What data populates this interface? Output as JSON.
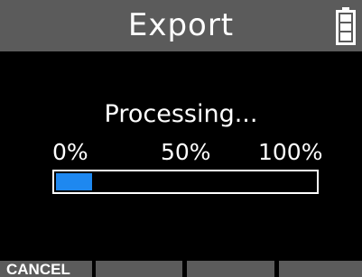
{
  "header": {
    "title": "Export",
    "battery_icon": "battery-full-icon"
  },
  "main": {
    "status_text": "Processing...",
    "progress": {
      "scale_min": "0%",
      "scale_mid": "50%",
      "scale_max": "100%",
      "value_fraction": 0.14,
      "fill_color": "#1e88f0"
    }
  },
  "softkeys": [
    {
      "label": "CANCEL"
    },
    {
      "label": ""
    },
    {
      "label": ""
    },
    {
      "label": ""
    }
  ],
  "colors": {
    "background": "#000000",
    "bar_gray": "#5b5b5b",
    "text": "#ffffff"
  }
}
